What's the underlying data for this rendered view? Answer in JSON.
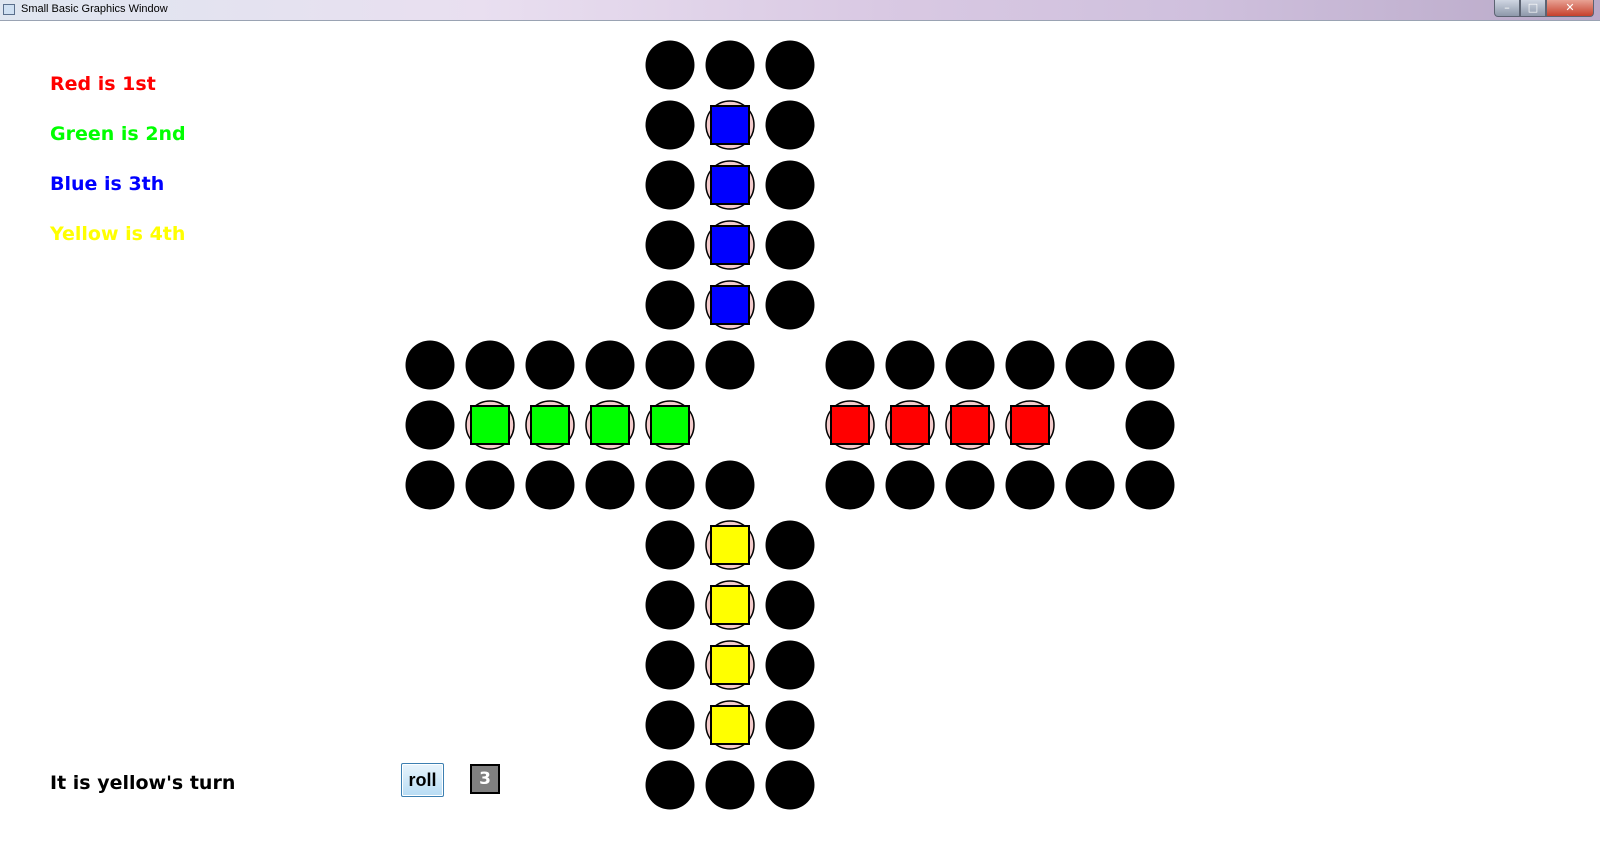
{
  "window": {
    "title": "Small Basic Graphics Window",
    "controls": {
      "minimize": "–",
      "maximize": "□",
      "close": "✕"
    }
  },
  "legend": [
    {
      "text": "Red is 1st",
      "color": "#ff0000"
    },
    {
      "text": "Green is 2nd",
      "color": "#00ff00"
    },
    {
      "text": "Blue is 3th",
      "color": "#0000ff"
    },
    {
      "text": "Yellow is 4th",
      "color": "#ffff00"
    }
  ],
  "status": {
    "turn_text": "It is yellow's turn"
  },
  "controls": {
    "roll_label": "roll",
    "die_value": "3"
  },
  "colors": {
    "track": "#000000",
    "home_circle": "#f4cccc",
    "red": "#ff0000",
    "green": "#00ff00",
    "blue": "#0000ff",
    "yellow": "#ffff00",
    "die": "#808080"
  },
  "board": {
    "grid_size": 13,
    "track_cells": [
      [
        4,
        0
      ],
      [
        5,
        0
      ],
      [
        6,
        0
      ],
      [
        4,
        1
      ],
      [
        6,
        1
      ],
      [
        4,
        2
      ],
      [
        6,
        2
      ],
      [
        4,
        3
      ],
      [
        6,
        3
      ],
      [
        4,
        4
      ],
      [
        6,
        4
      ],
      [
        0,
        5
      ],
      [
        1,
        5
      ],
      [
        2,
        5
      ],
      [
        3,
        5
      ],
      [
        4,
        5
      ],
      [
        5,
        5
      ],
      [
        7,
        5
      ],
      [
        8,
        5
      ],
      [
        9,
        5
      ],
      [
        10,
        5
      ],
      [
        11,
        5
      ],
      [
        12,
        5
      ],
      [
        0,
        6
      ],
      [
        12,
        6
      ],
      [
        0,
        7
      ],
      [
        1,
        7
      ],
      [
        2,
        7
      ],
      [
        3,
        7
      ],
      [
        4,
        7
      ],
      [
        5,
        7
      ],
      [
        7,
        7
      ],
      [
        8,
        7
      ],
      [
        9,
        7
      ],
      [
        10,
        7
      ],
      [
        11,
        7
      ],
      [
        12,
        7
      ],
      [
        4,
        8
      ],
      [
        6,
        8
      ],
      [
        4,
        9
      ],
      [
        6,
        9
      ],
      [
        4,
        10
      ],
      [
        6,
        10
      ],
      [
        4,
        11
      ],
      [
        6,
        11
      ],
      [
        4,
        12
      ],
      [
        5,
        12
      ],
      [
        6,
        12
      ]
    ],
    "pieces": [
      {
        "color": "blue",
        "cells": [
          [
            5,
            1
          ],
          [
            5,
            2
          ],
          [
            5,
            3
          ],
          [
            5,
            4
          ]
        ]
      },
      {
        "color": "green",
        "cells": [
          [
            1,
            6
          ],
          [
            2,
            6
          ],
          [
            3,
            6
          ],
          [
            4,
            6
          ]
        ]
      },
      {
        "color": "red",
        "cells": [
          [
            7,
            6
          ],
          [
            8,
            6
          ],
          [
            9,
            6
          ],
          [
            10,
            6
          ]
        ]
      },
      {
        "color": "yellow",
        "cells": [
          [
            5,
            8
          ],
          [
            5,
            9
          ],
          [
            5,
            10
          ],
          [
            5,
            11
          ]
        ]
      }
    ]
  }
}
